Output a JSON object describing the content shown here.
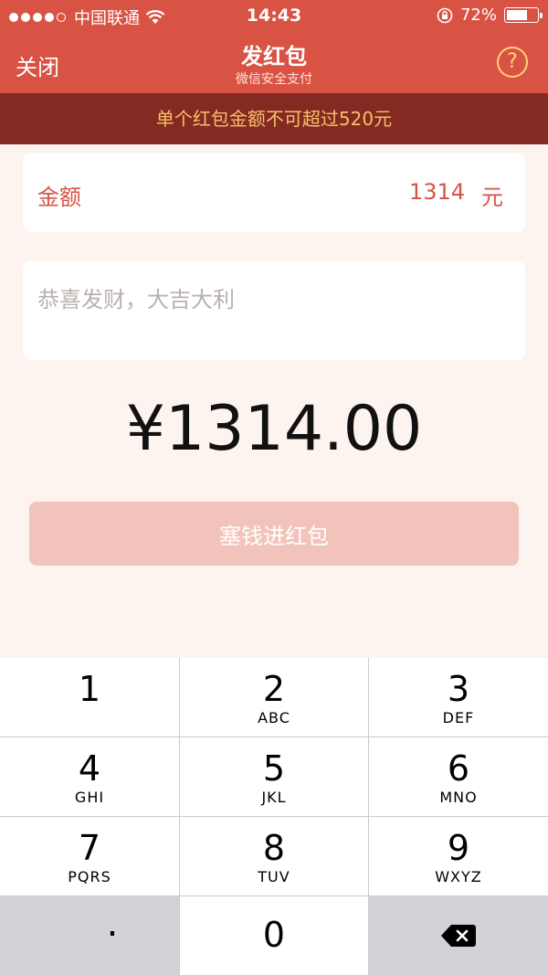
{
  "status_bar": {
    "carrier": "中国联通",
    "time": "14:43",
    "battery": "72%",
    "battery_fill": 0.72
  },
  "nav": {
    "close_label": "关闭",
    "title": "发红包",
    "subtitle": "微信安全支付",
    "help_label": "?"
  },
  "warning": "单个红包金额不可超过520元",
  "amount_field": {
    "label": "金额",
    "value": "1314",
    "unit": "元"
  },
  "message_field": {
    "placeholder": "恭喜发财，大吉大利",
    "value": ""
  },
  "total": "¥1314.00",
  "submit_label": "塞钱进红包",
  "keypad": {
    "keys": [
      {
        "num": "1",
        "letters": ""
      },
      {
        "num": "2",
        "letters": "ABC"
      },
      {
        "num": "3",
        "letters": "DEF"
      },
      {
        "num": "4",
        "letters": "GHI"
      },
      {
        "num": "5",
        "letters": "JKL"
      },
      {
        "num": "6",
        "letters": "MNO"
      },
      {
        "num": "7",
        "letters": "PQRS"
      },
      {
        "num": "8",
        "letters": "TUV"
      },
      {
        "num": "9",
        "letters": "WXYZ"
      },
      {
        "num": "0",
        "letters": ""
      }
    ],
    "dot": ".",
    "backspace_icon": "backspace-icon"
  },
  "colors": {
    "brand_red": "#d95344",
    "warning_bg": "#852a22",
    "warning_text": "#f5c06b",
    "button_disabled": "#f2c3bb"
  }
}
